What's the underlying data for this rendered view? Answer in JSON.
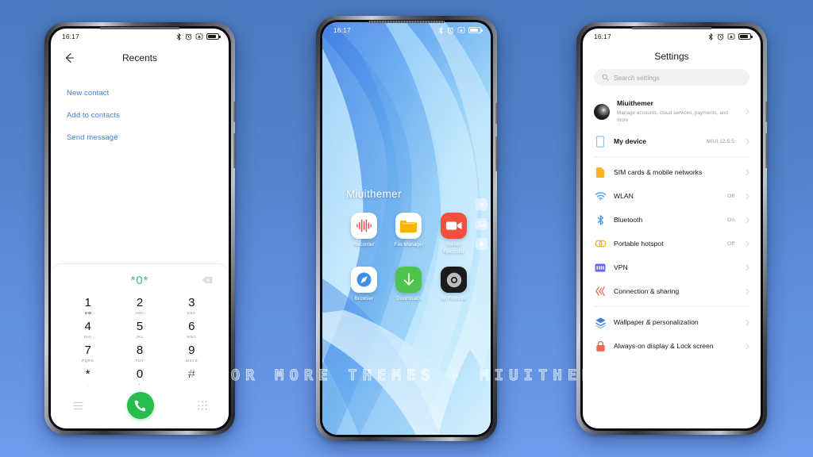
{
  "background": {
    "top_color": "#4a7ac0",
    "bottom_color": "#6d9bed"
  },
  "watermark": {
    "text": "VISIT FOR MORE THEMES - MIUITHEMER.COM"
  },
  "status_bar": {
    "time": "16:17",
    "icons": [
      "bluetooth-icon",
      "alarm-icon",
      "vibrate-icon",
      "battery-icon"
    ]
  },
  "phone_dialer": {
    "header": {
      "back_icon": "back-arrow-icon",
      "title": "Recents"
    },
    "links": [
      {
        "label": "New contact"
      },
      {
        "label": "Add to contacts"
      },
      {
        "label": "Send message"
      }
    ],
    "display": {
      "number": "*0*",
      "number_color": "#3ec36a",
      "delete_icon": "backspace-icon"
    },
    "keys": [
      {
        "num": "1",
        "sub": "",
        "voicemail": true
      },
      {
        "num": "2",
        "sub": "ABC"
      },
      {
        "num": "3",
        "sub": "DEF"
      },
      {
        "num": "4",
        "sub": "GHI"
      },
      {
        "num": "5",
        "sub": "JKL"
      },
      {
        "num": "6",
        "sub": "MNO"
      },
      {
        "num": "7",
        "sub": "PQRS"
      },
      {
        "num": "8",
        "sub": "TUV"
      },
      {
        "num": "9",
        "sub": "WXYZ"
      },
      {
        "num": "*",
        "sub": ","
      },
      {
        "num": "0",
        "sub": "+"
      },
      {
        "num": "#",
        "sub": ""
      }
    ],
    "actions": {
      "menu_icon": "menu-lines-icon",
      "call_icon": "phone-call-icon",
      "call_color": "#25bd4d",
      "keypad_icon": "keypad-dots-icon"
    }
  },
  "phone_home": {
    "folder_title": "Miuithemer",
    "apps": [
      {
        "label": "Recorder",
        "icon": "recorder-icon",
        "bg": "#ffffff",
        "fg": "#e84b4b"
      },
      {
        "label": "File Manager",
        "icon": "folder-icon",
        "bg": "#ffffff",
        "fg": "#f7b500"
      },
      {
        "label": "Screen Recorder",
        "icon": "video-camera-icon",
        "bg": "#f2503c",
        "fg": "#ffffff"
      },
      {
        "label": "Browser",
        "icon": "browser-compass-icon",
        "bg": "#ffffff",
        "fg": "#3f8fe8"
      },
      {
        "label": "Downloads",
        "icon": "download-arrow-icon",
        "bg": "#4ec44e",
        "fg": "#ffffff"
      },
      {
        "label": "Mi Remote",
        "icon": "remote-dial-icon",
        "bg": "#1b1b1b",
        "fg": "#b9bcc2"
      }
    ],
    "edge_tools": [
      "close-icon",
      "gallery-icon",
      "water-drop-icon"
    ]
  },
  "phone_settings": {
    "title": "Settings",
    "search": {
      "placeholder": "Search settings",
      "icon": "search-icon"
    },
    "account": {
      "name": "Miuithemer",
      "subtitle": "Manage accounts, cloud services, payments, and more",
      "avatar": "avatar"
    },
    "device": {
      "label": "My device",
      "value": "MIUI 12.5.5",
      "icon": "device-icon"
    },
    "groups": [
      {
        "items": [
          {
            "label": "SIM cards & mobile networks",
            "value": "",
            "icon": "sim-card-icon",
            "color": "#f5b324"
          },
          {
            "label": "WLAN",
            "value": "Off",
            "icon": "wifi-icon",
            "color": "#4a9ff0"
          },
          {
            "label": "Bluetooth",
            "value": "On",
            "icon": "bluetooth-icon",
            "color": "#4a9ff0"
          },
          {
            "label": "Portable hotspot",
            "value": "Off",
            "icon": "hotspot-icon",
            "color": "#f5b324"
          },
          {
            "label": "VPN",
            "value": "",
            "icon": "vpn-icon",
            "color": "#6366f1"
          },
          {
            "label": "Connection & sharing",
            "value": "",
            "icon": "connection-sharing-icon",
            "color": "#ef6a53"
          }
        ]
      },
      {
        "items": [
          {
            "label": "Wallpaper & personalization",
            "value": "",
            "icon": "wallpaper-icon",
            "color": "#3f7ddb"
          },
          {
            "label": "Always-on display & Lock screen",
            "value": "",
            "icon": "lock-icon",
            "color": "#ef6a53"
          }
        ]
      }
    ]
  }
}
